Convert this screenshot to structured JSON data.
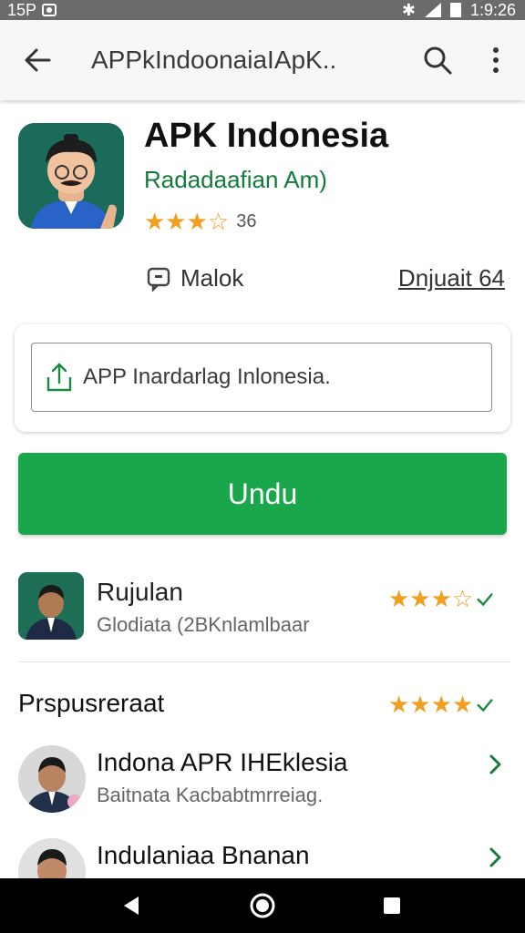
{
  "status_bar": {
    "time_left": "15P",
    "time_right": "1:9:26"
  },
  "app_bar": {
    "title": "APPkIndoonaiaIApK.."
  },
  "app": {
    "name": "APK Indonesia",
    "developer": "Radadaafian Am)",
    "rating_stars": "★★★☆",
    "rating_count": "36",
    "meta_left": "Malok",
    "meta_right": "Dnjuait 64"
  },
  "field": {
    "value": "APP Inardarlag Inlonesia."
  },
  "install_button": {
    "label": "Undu"
  },
  "related": {
    "title": "Rujulan",
    "subtitle": "Glodiata (2BKnlamlbaar",
    "stars": "★★★☆"
  },
  "section": {
    "title": "Prspusreraat",
    "stars": "★★★★"
  },
  "list": [
    {
      "title": "Indona APR IHEklesia",
      "subtitle": "Baitnata Kacbabtmrreiag."
    },
    {
      "title": "Indulaniaa Bnanan",
      "subtitle": ""
    }
  ],
  "colors": {
    "accent": "#1aa64a",
    "star": "#f0a020",
    "developer": "#137a3c"
  }
}
